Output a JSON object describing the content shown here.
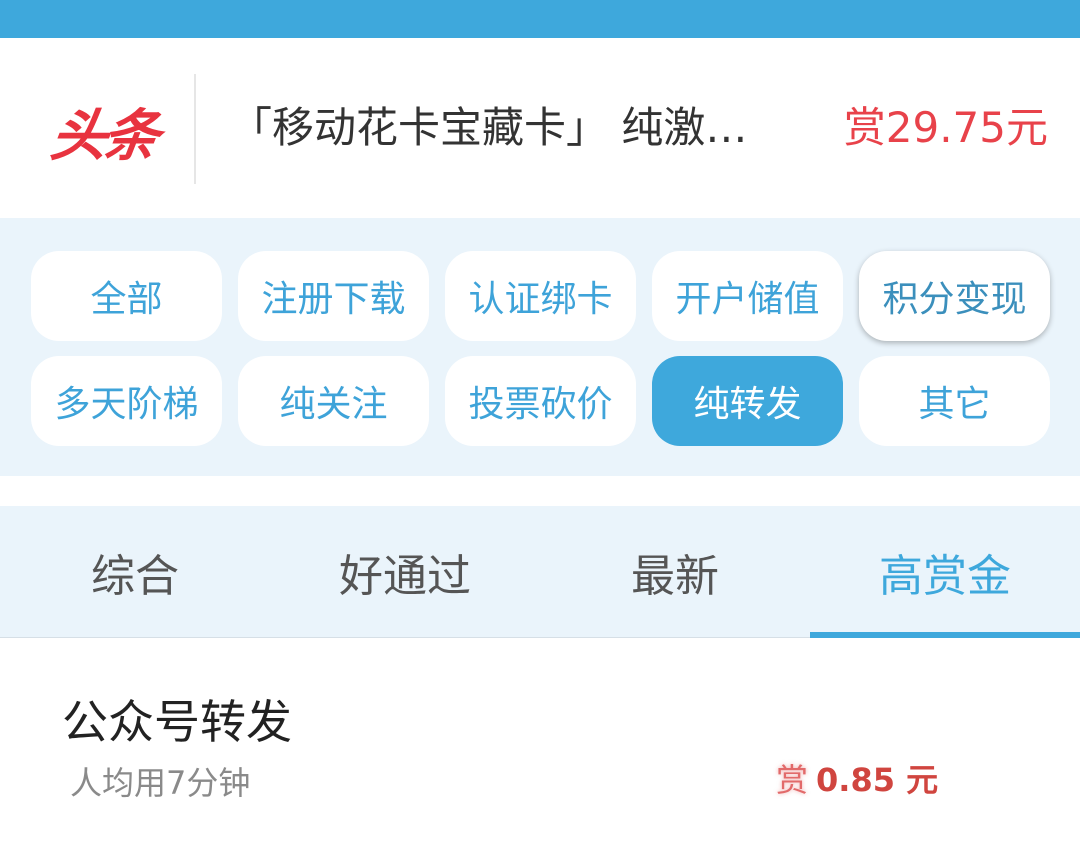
{
  "headline": {
    "brand": "头条",
    "text": "「移动花卡宝藏卡」 纯激…",
    "reward": "赏29.75元"
  },
  "categories": [
    {
      "label": "全部",
      "active": false
    },
    {
      "label": "注册下载",
      "active": false
    },
    {
      "label": "认证绑卡",
      "active": false
    },
    {
      "label": "开户储值",
      "active": false
    },
    {
      "label": "积分变现",
      "active": false
    },
    {
      "label": "多天阶梯",
      "active": false
    },
    {
      "label": "纯关注",
      "active": false
    },
    {
      "label": "投票砍价",
      "active": false
    },
    {
      "label": "纯转发",
      "active": true
    },
    {
      "label": "其它",
      "active": false
    }
  ],
  "sort_tabs": [
    {
      "label": "综合",
      "active": false
    },
    {
      "label": "好通过",
      "active": false
    },
    {
      "label": "最新",
      "active": false
    },
    {
      "label": "高赏金",
      "active": true
    }
  ],
  "tasks": [
    {
      "title": "公众号转发",
      "meta": "人均用7分钟",
      "reward_mark": "赏",
      "reward_amount": "0.85 元"
    }
  ],
  "colors": {
    "accent": "#3ea8dc",
    "brand_red": "#e8333f",
    "reward_red": "#e8424a",
    "panel_bg": "#eaf4fb"
  }
}
